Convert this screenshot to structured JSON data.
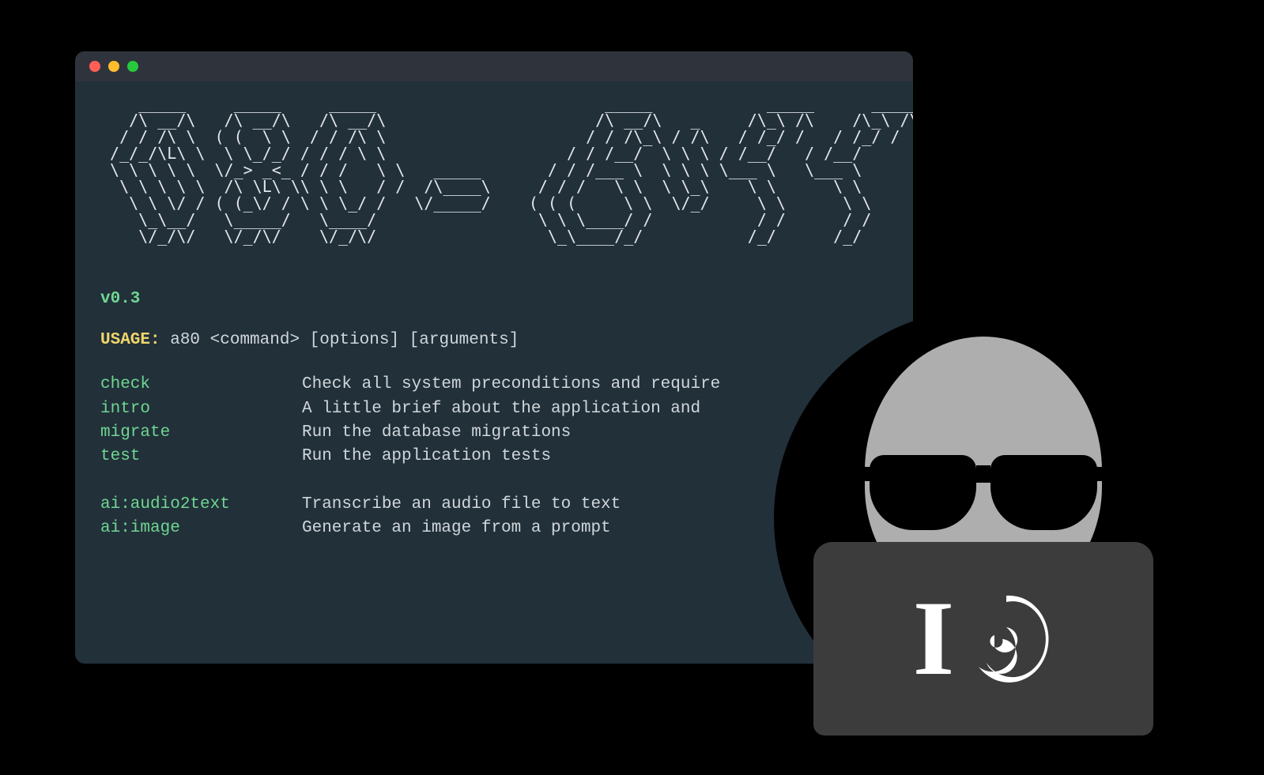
{
  "ascii_art": "    _____     _____     _____                        _____            _____      _____  \n   /\\ __/\\   /\\ __/\\   /\\ __/\\                      /\\ __/\\   _     /\\_\\ /\\    /\\_\\ /\\  \n  / / /\\ \\  ( (  \\ \\  / / /\\ \\                     / / /\\_\\ / /\\   / /_/ /   / /_/ /  \n /_/_/\\L\\ \\  \\ \\_/_/ / / / \\ \\                   / / /__/  \\ \\ \\ / /__/   / /__/   \n \\ \\ \\ \\ \\  \\/_> _<_ / / /   \\ \\   _____       / / /___ \\  \\ \\ \\ \\___ \\   \\___ \\   \n  \\ \\ \\ \\ \\  /\\ \\L\\ \\\\ \\ \\   / /  /\\____\\     / / /   \\ \\  \\ \\_\\    \\ \\      \\ \\  \n   \\ \\ \\/ / ( (_\\/ / \\ \\ \\_/ /   \\/_____/    ( ( (     \\ \\  \\/_/     \\ \\      \\ \\ \n    \\_\\__/   \\_____/   \\____/                 \\ \\ \\____/ /           / /      / / \n    \\/_/\\/   \\/_/\\/    \\/_/\\/                  \\_\\____/_/           /_/      /_/  ",
  "version": "v0.3",
  "usage": {
    "label": "USAGE:",
    "text": " a80 <command> [options] [arguments]"
  },
  "commands": [
    {
      "name": "check",
      "desc": "Check all system preconditions and require"
    },
    {
      "name": "intro",
      "desc": "A little brief about the application and"
    },
    {
      "name": "migrate",
      "desc": "Run the database migrations"
    },
    {
      "name": "test",
      "desc": "Run the application tests"
    }
  ],
  "ai_commands": [
    {
      "name": "ai:audio2text",
      "desc": "Transcribe an audio file to text"
    },
    {
      "name": "ai:image",
      "desc": "Generate an image from a prompt"
    }
  ],
  "logo_text": "I"
}
